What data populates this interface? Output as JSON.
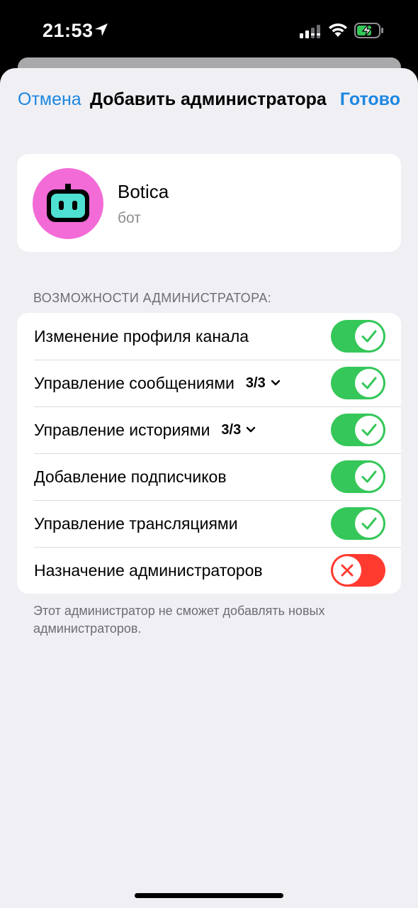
{
  "status_bar": {
    "time": "21:53",
    "icons": [
      "location-icon",
      "signal-icon",
      "wifi-icon",
      "battery-charging-icon"
    ]
  },
  "nav": {
    "cancel": "Отмена",
    "title": "Добавить администратора",
    "done": "Готово"
  },
  "profile": {
    "name": "Botica",
    "subtitle": "бот",
    "avatar_color": "#f26bd7"
  },
  "rights": {
    "header": "ВОЗМОЖНОСТИ АДМИНИСТРАТОРА:",
    "items": [
      {
        "label": "Изменение профиля канала",
        "count": "",
        "enabled": true
      },
      {
        "label": "Управление сообщениями",
        "count": "3/3",
        "enabled": true
      },
      {
        "label": "Управление историями",
        "count": "3/3",
        "enabled": true
      },
      {
        "label": "Добавление подписчиков",
        "count": "",
        "enabled": true
      },
      {
        "label": "Управление трансляциями",
        "count": "",
        "enabled": true
      },
      {
        "label": "Назначение администраторов",
        "count": "",
        "enabled": false
      }
    ],
    "footer": "Этот администратор не сможет добавлять новых администраторов."
  },
  "colors": {
    "accent": "#1c87e0",
    "toggle_on": "#35c759",
    "toggle_off": "#ff3b30",
    "background": "#efeff4"
  }
}
